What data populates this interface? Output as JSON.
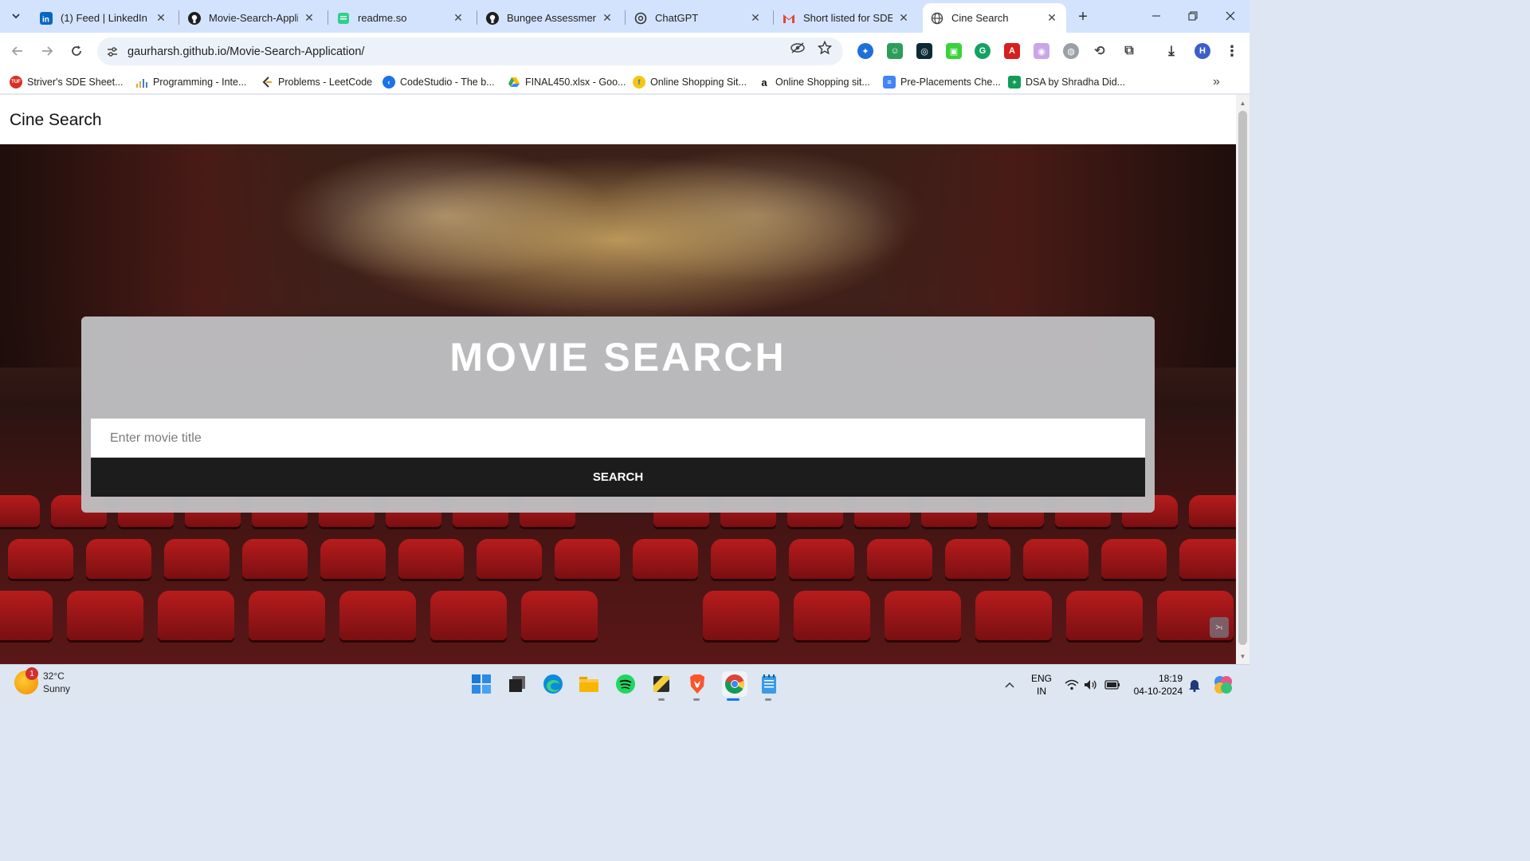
{
  "browser": {
    "tabs": [
      {
        "title": "(1) Feed | LinkedIn",
        "icon": "linkedin-icon",
        "active": false
      },
      {
        "title": "Movie-Search-Applic",
        "icon": "github-icon",
        "active": false
      },
      {
        "title": "readme.so",
        "icon": "readme-icon",
        "active": false
      },
      {
        "title": "Bungee Assessment",
        "icon": "github-icon",
        "active": false
      },
      {
        "title": "ChatGPT",
        "icon": "chatgpt-icon",
        "active": false
      },
      {
        "title": "Short listed for SDE",
        "icon": "gmail-icon",
        "active": false
      },
      {
        "title": "Cine Search",
        "icon": "globe-icon",
        "active": true
      }
    ],
    "new_tab": "+",
    "url": "gaurharsh.github.io/Movie-Search-Application/",
    "bookmarks": [
      {
        "label": "Striver's SDE Sheet...",
        "icon": "tuf-icon",
        "color": "#d93025"
      },
      {
        "label": "Programming - Inte...",
        "icon": "chart-icon",
        "color": "#e8a33c"
      },
      {
        "label": "Problems - LeetCode",
        "icon": "leetcode-icon",
        "color": "#333333"
      },
      {
        "label": "CodeStudio - The b...",
        "icon": "codestudio-icon",
        "color": "#1a73e8"
      },
      {
        "label": "FINAL450.xlsx - Goo...",
        "icon": "drive-icon",
        "color": "#34a853"
      },
      {
        "label": "Online Shopping Sit...",
        "icon": "flipkart-icon",
        "color": "#2874f0"
      },
      {
        "label": "Online Shopping sit...",
        "icon": "amazon-icon",
        "color": "#111111"
      },
      {
        "label": "Pre-Placements Che...",
        "icon": "docs-icon",
        "color": "#4285f4"
      },
      {
        "label": "DSA by Shradha Did...",
        "icon": "sheets-icon",
        "color": "#0f9d58"
      }
    ],
    "profile_initial": "H"
  },
  "page": {
    "brand": "Cine Search",
    "search": {
      "title": "MOVIE SEARCH",
      "placeholder": "Enter movie title",
      "value": "",
      "button_label": "SEARCH"
    }
  },
  "taskbar": {
    "weather": {
      "temp": "32°C",
      "condition": "Sunny",
      "badge": "1"
    },
    "lang_top": "ENG",
    "lang_bottom": "IN",
    "time": "18:19",
    "date": "04-10-2024",
    "apps": [
      "windows-start-icon",
      "task-view-icon",
      "edge-icon",
      "file-explorer-icon",
      "spotify-icon",
      "sticky-notes-icon",
      "brave-icon",
      "chrome-icon",
      "notepad-icon"
    ]
  },
  "colors": {
    "tabstrip": "#d3e3fd",
    "card": "#bebec0",
    "button": "#1c1c1c"
  }
}
